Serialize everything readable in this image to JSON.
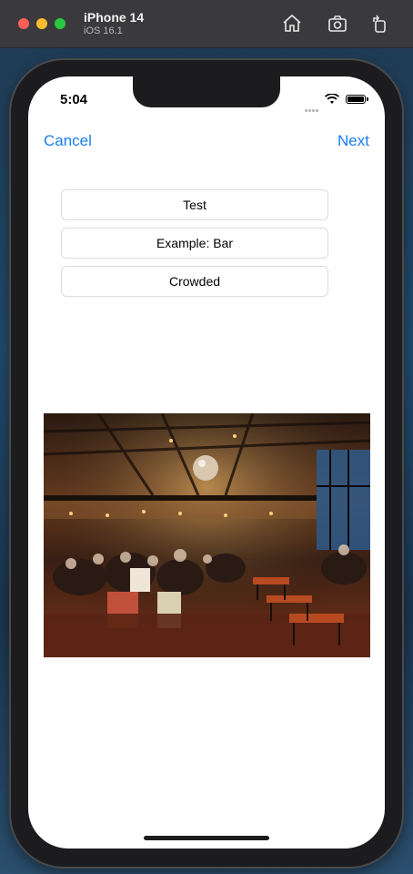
{
  "simulator": {
    "device_name": "iPhone 14",
    "os_version": "iOS 16.1",
    "icons": [
      "home-icon",
      "screenshot-icon",
      "rotate-icon"
    ]
  },
  "status_bar": {
    "time": "5:04"
  },
  "nav": {
    "cancel_label": "Cancel",
    "next_label": "Next"
  },
  "form": {
    "field1_value": "Test",
    "field2_placeholder": "Example: Bar",
    "field3_value": "Crowded"
  },
  "colors": {
    "accent": "#1a7cf0"
  }
}
